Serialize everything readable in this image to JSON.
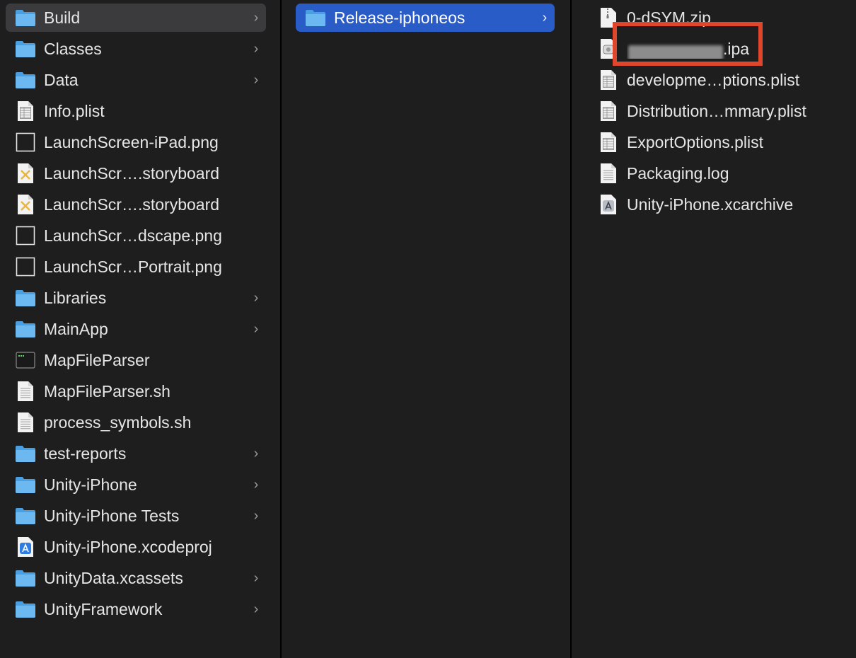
{
  "columns": {
    "col1": {
      "items": [
        {
          "label": "Build",
          "icon": "folder-icon",
          "chevron": "›",
          "selected": true
        },
        {
          "label": "Classes",
          "icon": "folder-icon",
          "chevron": "›"
        },
        {
          "label": "Data",
          "icon": "folder-icon",
          "chevron": "›"
        },
        {
          "label": "Info.plist",
          "icon": "plist-file-icon"
        },
        {
          "label": "LaunchScreen-iPad.png",
          "icon": "image-file-icon"
        },
        {
          "label": "LaunchScr….storyboard",
          "icon": "storyboard-file-icon"
        },
        {
          "label": "LaunchScr….storyboard",
          "icon": "storyboard-file-icon"
        },
        {
          "label": "LaunchScr…dscape.png",
          "icon": "image-file-icon"
        },
        {
          "label": "LaunchScr…Portrait.png",
          "icon": "image-file-icon"
        },
        {
          "label": "Libraries",
          "icon": "folder-icon",
          "chevron": "›"
        },
        {
          "label": "MainApp",
          "icon": "folder-icon",
          "chevron": "›"
        },
        {
          "label": "MapFileParser",
          "icon": "terminal-executable-icon"
        },
        {
          "label": "MapFileParser.sh",
          "icon": "script-file-icon"
        },
        {
          "label": "process_symbols.sh",
          "icon": "script-file-icon"
        },
        {
          "label": "test-reports",
          "icon": "folder-icon",
          "chevron": "›"
        },
        {
          "label": "Unity-iPhone",
          "icon": "folder-icon",
          "chevron": "›"
        },
        {
          "label": "Unity-iPhone Tests",
          "icon": "folder-icon",
          "chevron": "›"
        },
        {
          "label": "Unity-iPhone.xcodeproj",
          "icon": "xcode-project-icon"
        },
        {
          "label": "UnityData.xcassets",
          "icon": "folder-icon",
          "chevron": "›"
        },
        {
          "label": "UnityFramework",
          "icon": "folder-icon",
          "chevron": "›"
        }
      ]
    },
    "col2": {
      "items": [
        {
          "label": "Release-iphoneos",
          "icon": "folder-icon",
          "chevron": "›",
          "selected": true
        }
      ]
    },
    "col3": {
      "items": [
        {
          "label": "0-dSYM.zip",
          "icon": "zip-file-icon"
        },
        {
          "label": ".ipa",
          "icon": "ipa-file-icon",
          "redacted_prefix": true
        },
        {
          "label": "developme…ptions.plist",
          "icon": "plist-file-icon"
        },
        {
          "label": "Distribution…mmary.plist",
          "icon": "plist-file-icon"
        },
        {
          "label": "ExportOptions.plist",
          "icon": "plist-file-icon"
        },
        {
          "label": "Packaging.log",
          "icon": "log-file-icon"
        },
        {
          "label": "Unity-iPhone.xcarchive",
          "icon": "xcarchive-file-icon"
        }
      ]
    }
  },
  "colors": {
    "background": "#1e1e1e",
    "selected_inactive": "#3b3b3d",
    "selected_active": "#2a5cc8",
    "annotation": "#e0462c",
    "folder_blue": "#5fb0ec"
  }
}
